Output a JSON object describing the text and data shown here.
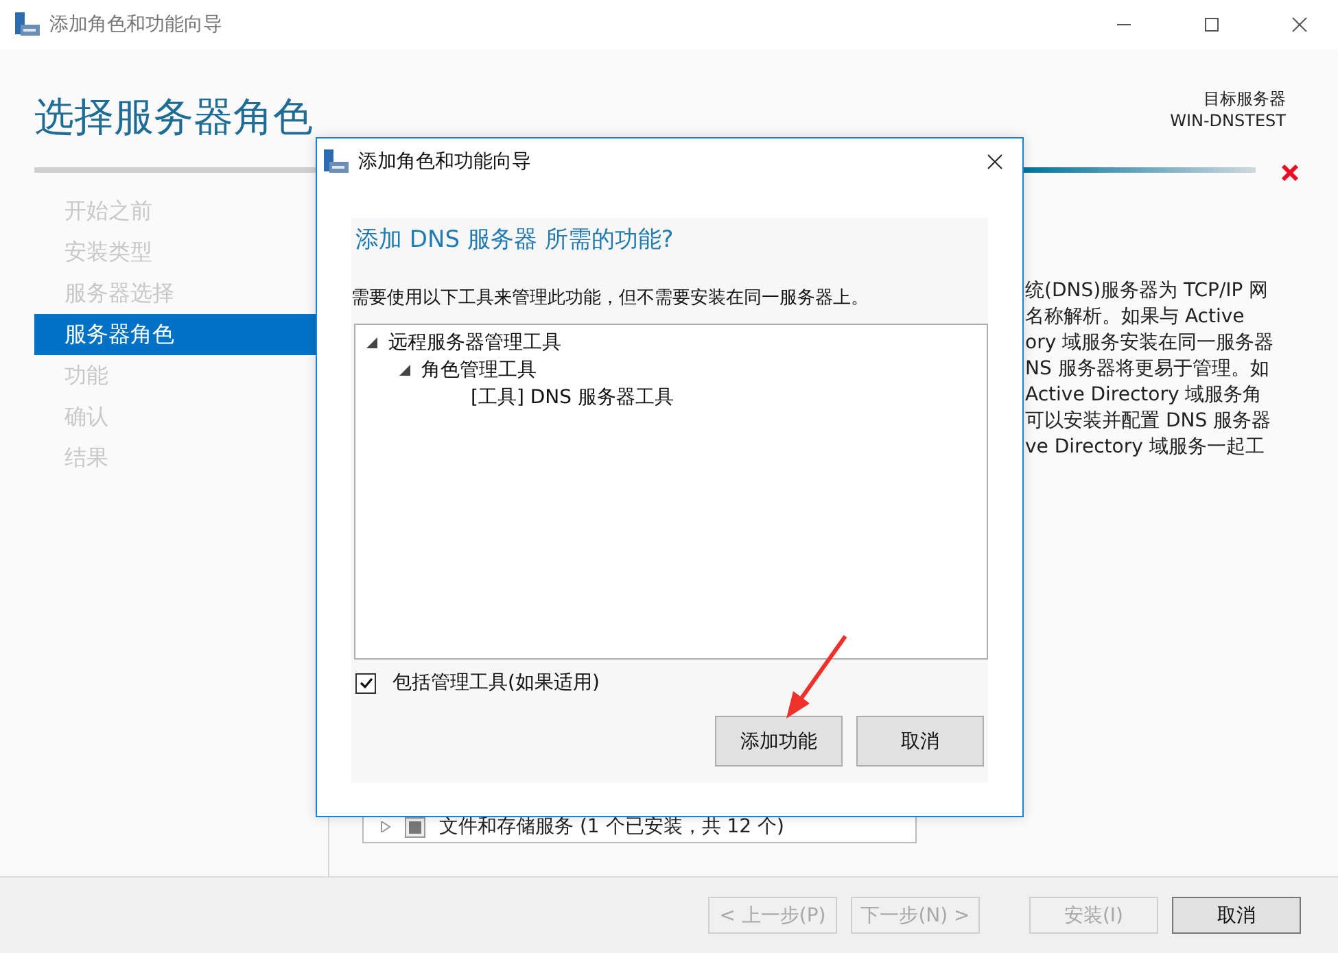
{
  "window": {
    "title": "添加角色和功能向导"
  },
  "page_title": "选择服务器角色",
  "target_server": {
    "label": "目标服务器",
    "name": "WIN-DNSTEST"
  },
  "nav": [
    {
      "label": "开始之前",
      "selected": false
    },
    {
      "label": "安装类型",
      "selected": false
    },
    {
      "label": "服务器选择",
      "selected": false
    },
    {
      "label": "服务器角色",
      "selected": true
    },
    {
      "label": "功能",
      "selected": false
    },
    {
      "label": "确认",
      "selected": false
    },
    {
      "label": "结果",
      "selected": false
    }
  ],
  "description_lines": [
    "统(DNS)服务器为 TCP/IP 网",
    "名称解析。如果与 Active",
    "ory 域服务安装在同一服务器",
    "NS 服务器将更易于管理。如",
    " Active Directory 域服务角",
    "可以安装并配置 DNS 服务器",
    "ve Directory 域服务一起工"
  ],
  "roles_list": {
    "rows": [
      {
        "label": "文件和存储服务 (1 个已安装，共 12 个)",
        "expanded": false,
        "indeterminate": true
      }
    ]
  },
  "footer_buttons": [
    {
      "label": "< 上一步(P)",
      "disabled": true
    },
    {
      "label": "下一步(N) >",
      "disabled": true
    },
    {
      "label": "安装(I)",
      "disabled": true
    },
    {
      "label": "取消",
      "disabled": false
    }
  ],
  "dialog": {
    "title": "添加角色和功能向导",
    "heading": "添加 DNS 服务器 所需的功能?",
    "message": "需要使用以下工具来管理此功能，但不需要安装在同一服务器上。",
    "tree": [
      {
        "label": "远程服务器管理工具",
        "expanded": true,
        "children": [
          {
            "label": "角色管理工具",
            "expanded": true,
            "children": [
              {
                "label": "[工具] DNS 服务器工具"
              }
            ]
          }
        ]
      }
    ],
    "include_tools": {
      "label": "包括管理工具(如果适用)",
      "checked": true
    },
    "buttons": [
      {
        "label": "添加功能"
      },
      {
        "label": "取消"
      }
    ]
  }
}
